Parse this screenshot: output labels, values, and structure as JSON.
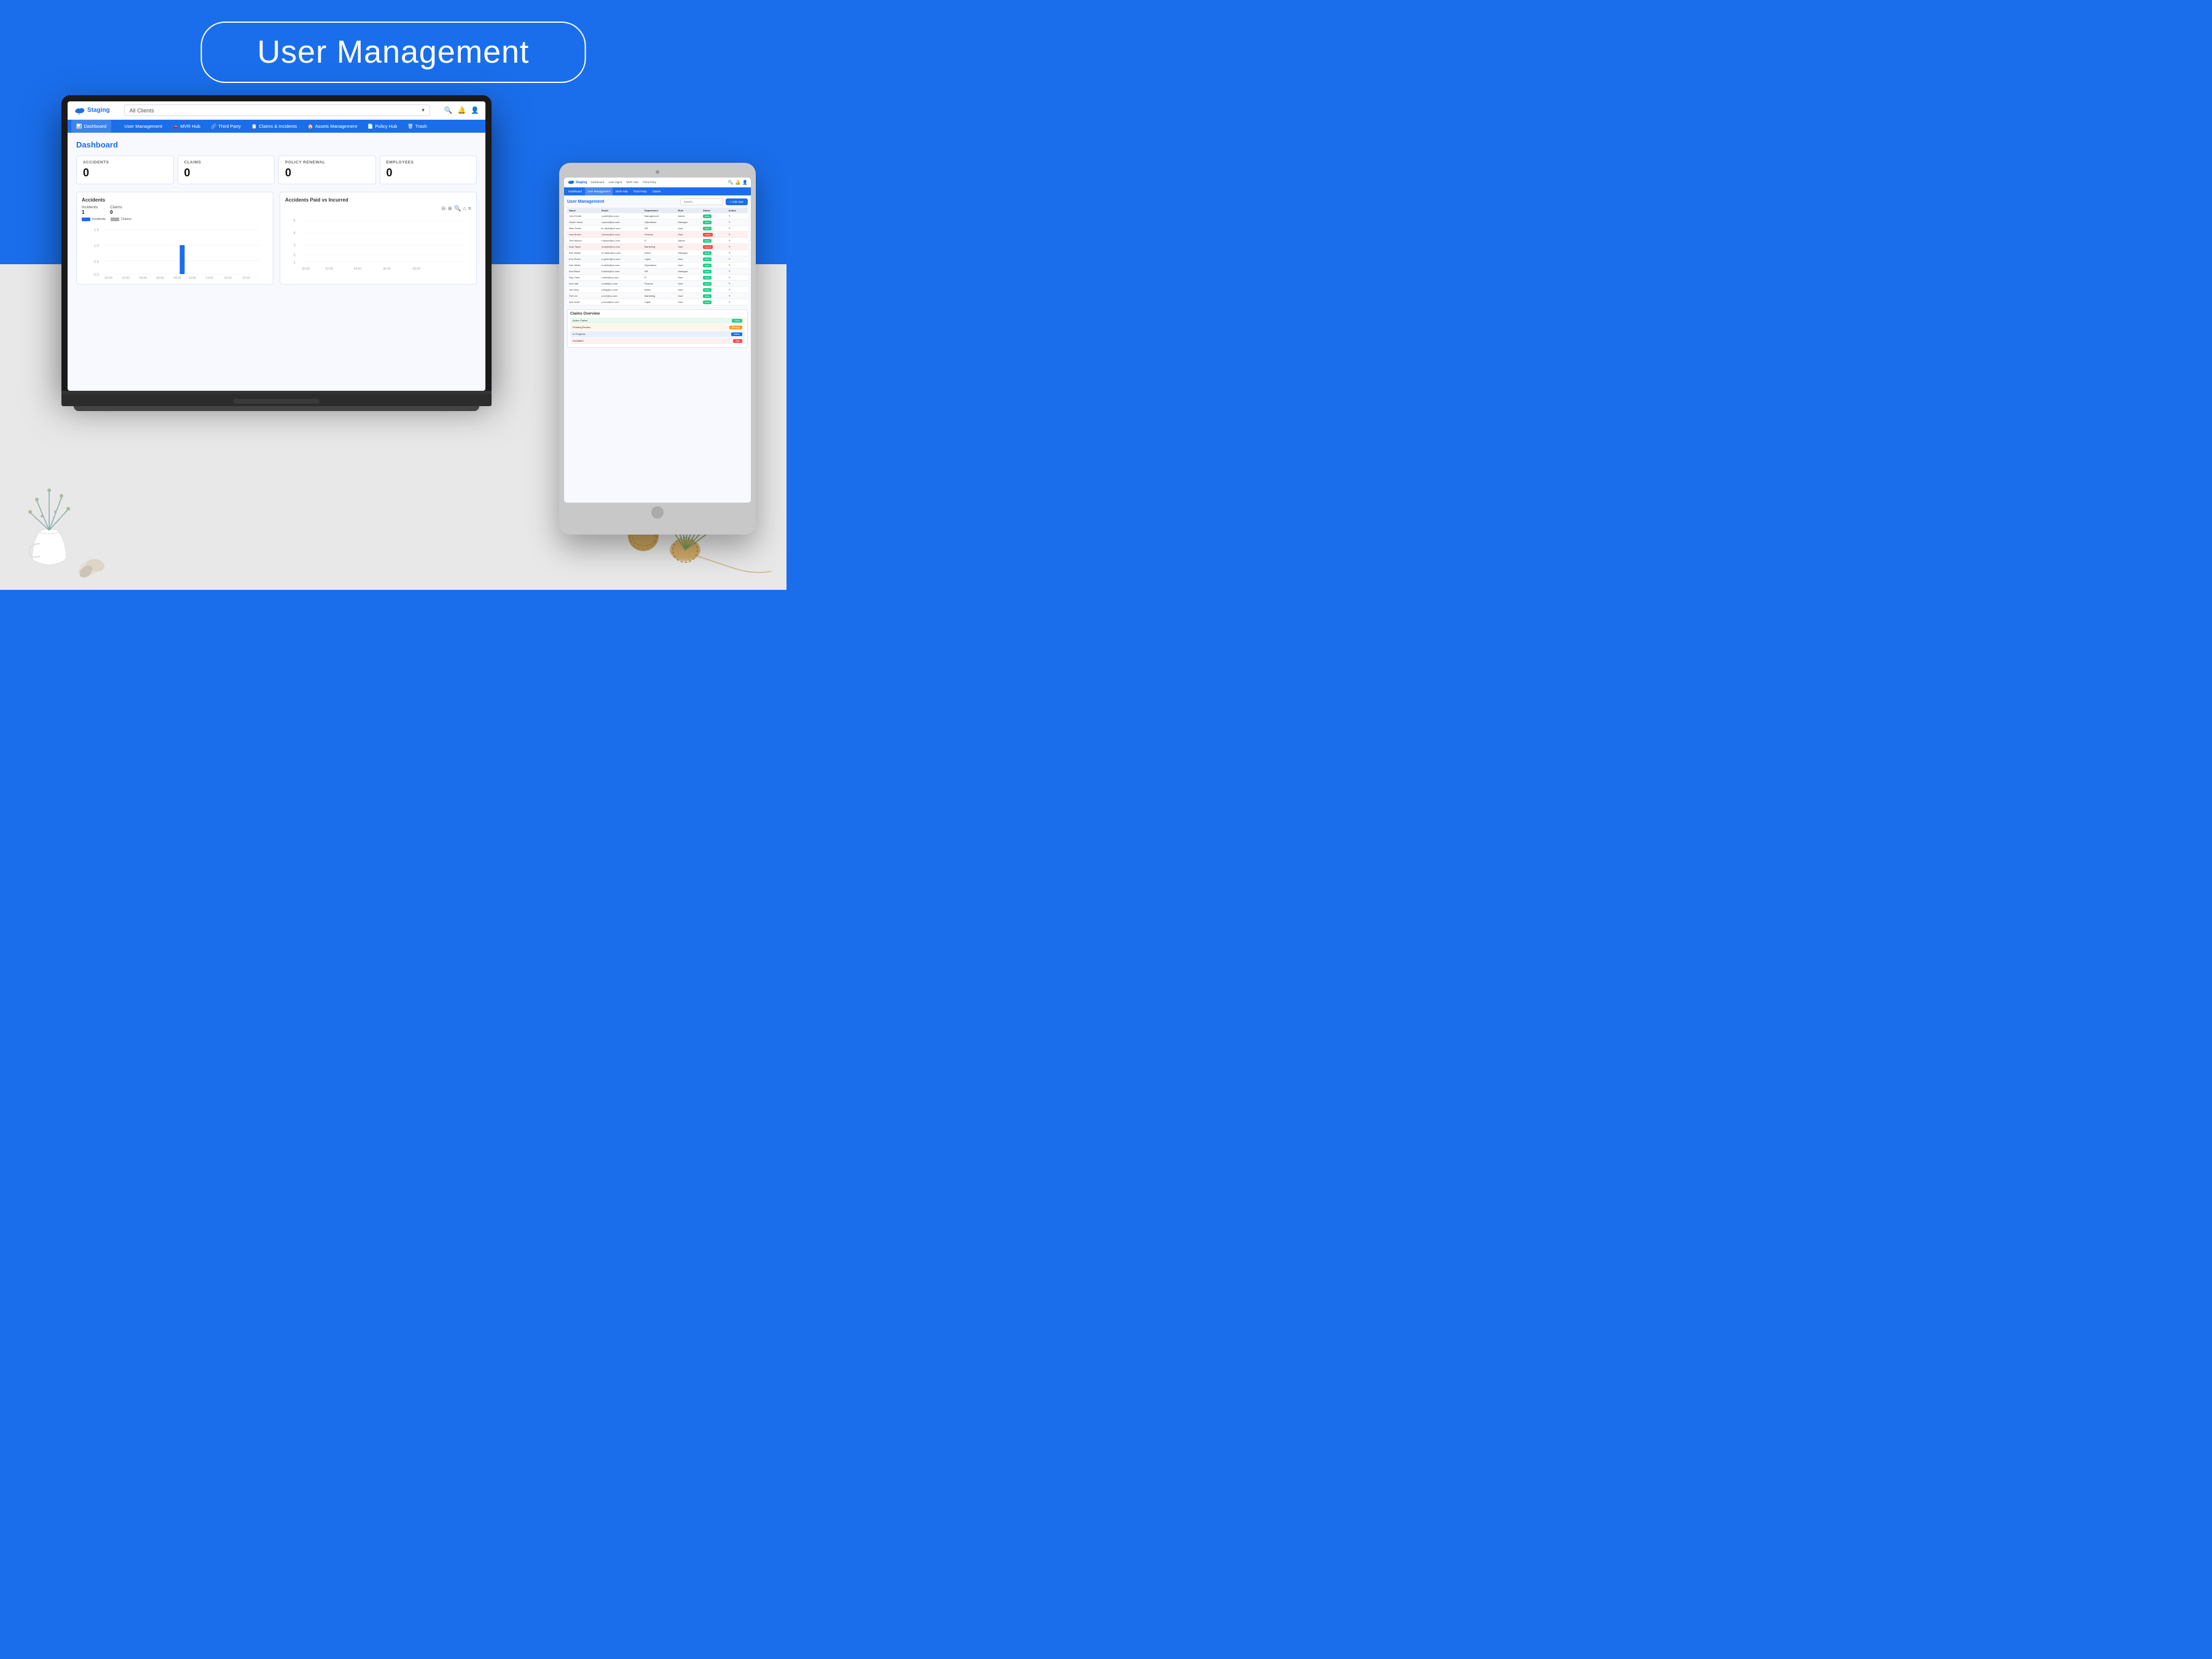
{
  "page": {
    "title": "User Management",
    "background_color": "#1a6eeb"
  },
  "header": {
    "title_badge": "User Management"
  },
  "laptop": {
    "topbar": {
      "app_name": "Staging",
      "search_placeholder": "All Clients",
      "search_dropdown": "All Clients"
    },
    "nav": {
      "items": [
        {
          "label": "Dashboard",
          "icon": "📊",
          "active": true
        },
        {
          "label": "User Management",
          "icon": "👤",
          "active": false
        },
        {
          "label": "MVR Hub",
          "icon": "🚗",
          "active": false
        },
        {
          "label": "Third Party",
          "icon": "🔗",
          "active": false
        },
        {
          "label": "Claims & Incidents",
          "icon": "📋",
          "active": false
        },
        {
          "label": "Assets Management",
          "icon": "🏠",
          "active": false
        },
        {
          "label": "Policy Hub",
          "icon": "📄",
          "active": false
        },
        {
          "label": "Trash",
          "icon": "🗑",
          "active": false
        }
      ]
    },
    "dashboard": {
      "title": "Dashboard",
      "stats": [
        {
          "label": "ACCIDENTS",
          "value": "0"
        },
        {
          "label": "CLAIMS",
          "value": "0"
        },
        {
          "label": "POLICY RENEWAL",
          "value": "0"
        },
        {
          "label": "EMPLOYEES",
          "value": "0"
        }
      ],
      "accidents_chart": {
        "title": "Accidents",
        "incidents_label": "Incidents",
        "incidents_value": "1",
        "claims_label": "Claims",
        "claims_value": "0",
        "legend_incidents": "Incidents",
        "legend_claims": "Claims"
      },
      "paid_vs_incurred_chart": {
        "title": "Accidents Paid vs Incurred"
      }
    }
  },
  "tablet": {
    "section_title": "User Management",
    "search_placeholder": "Search",
    "add_button": "+ Add User",
    "table_headers": [
      "Name",
      "Email",
      "Department",
      "Role",
      "Status",
      "Action"
    ],
    "rows": [
      {
        "name": "John Smith",
        "email": "j.smith@co.com",
        "dept": "Management",
        "role": "Admin",
        "status": "Active"
      },
      {
        "name": "Sarah Jones",
        "email": "s.jones@co.com",
        "dept": "Operations",
        "role": "Manager",
        "status": "Active"
      },
      {
        "name": "Mike Davis",
        "email": "m.davis@co.com",
        "dept": "HR",
        "role": "User",
        "status": "Active"
      },
      {
        "name": "Lisa Brown",
        "email": "l.brown@co.com",
        "dept": "Finance",
        "role": "User",
        "status": "Inactive"
      },
      {
        "name": "Tom Wilson",
        "email": "t.wilson@co.com",
        "dept": "IT",
        "role": "Admin",
        "status": "Active"
      },
      {
        "name": "Amy Taylor",
        "email": "a.taylor@co.com",
        "dept": "Marketing",
        "role": "User",
        "status": "Inactive"
      },
      {
        "name": "Bob Martin",
        "email": "b.martin@co.com",
        "dept": "Sales",
        "role": "Manager",
        "status": "Active"
      },
      {
        "name": "Eva Green",
        "email": "e.green@co.com",
        "dept": "Legal",
        "role": "User",
        "status": "Active"
      },
      {
        "name": "Dan White",
        "email": "d.white@co.com",
        "dept": "Operations",
        "role": "User",
        "status": "Active"
      },
      {
        "name": "Kim Black",
        "email": "k.black@co.com",
        "dept": "HR",
        "role": "Manager",
        "status": "Active"
      },
      {
        "name": "Ray Clark",
        "email": "r.clark@co.com",
        "dept": "IT",
        "role": "User",
        "status": "Active"
      },
      {
        "name": "Sue Hall",
        "email": "s.hall@co.com",
        "dept": "Finance",
        "role": "User",
        "status": "Active"
      },
      {
        "name": "Joe King",
        "email": "j.king@co.com",
        "dept": "Sales",
        "role": "User",
        "status": "Active"
      },
      {
        "name": "Pat Lee",
        "email": "p.lee@co.com",
        "dept": "Marketing",
        "role": "User",
        "status": "Active"
      },
      {
        "name": "Ann Scott",
        "email": "a.scott@co.com",
        "dept": "Legal",
        "role": "User",
        "status": "Active"
      }
    ]
  },
  "detected_text": {
    "claims": "CLAIMS",
    "trash": "Trash",
    "third_party": "Third Party"
  }
}
